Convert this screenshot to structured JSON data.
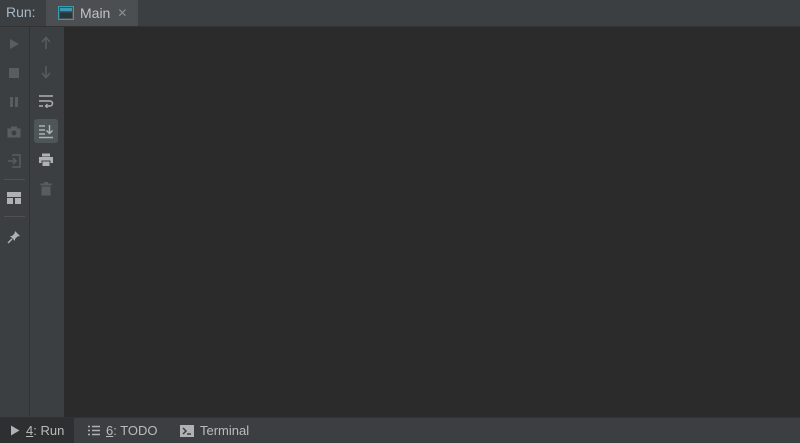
{
  "run_panel": {
    "label": "Run:",
    "tab": {
      "label": "Main",
      "icon": "console-icon",
      "close_glyph": "✕"
    }
  },
  "left_toolbar": [
    {
      "name": "rerun-icon",
      "enabled": false
    },
    {
      "name": "stop-icon",
      "enabled": false
    },
    {
      "name": "pause-icon",
      "enabled": false
    },
    {
      "name": "camera-icon",
      "enabled": false
    },
    {
      "name": "exit-icon",
      "enabled": false
    },
    {
      "name": "layout-icon",
      "enabled": true
    },
    {
      "name": "pin-icon",
      "enabled": true
    }
  ],
  "console_toolbar": [
    {
      "name": "up-arrow-icon",
      "enabled": false
    },
    {
      "name": "down-arrow-icon",
      "enabled": false
    },
    {
      "name": "soft-wrap-icon",
      "enabled": true
    },
    {
      "name": "scroll-to-end-icon",
      "enabled": true,
      "selected": true
    },
    {
      "name": "print-icon",
      "enabled": true
    },
    {
      "name": "trash-icon",
      "enabled": false
    }
  ],
  "bottom_bar": {
    "items": [
      {
        "mnemonic": "4",
        "label": ": Run",
        "icon": "play-icon",
        "active": true
      },
      {
        "mnemonic": "6",
        "label": ": TODO",
        "icon": "list-icon",
        "active": false
      },
      {
        "mnemonic": "",
        "label": "Terminal",
        "icon": "terminal-icon",
        "active": false
      }
    ]
  },
  "colors": {
    "panel": "#3c3f41",
    "console_bg": "#2b2b2c",
    "icon_enabled": "#afb1b3",
    "icon_disabled": "#5a5d5f",
    "tab_icon": "#3a9bb0"
  }
}
